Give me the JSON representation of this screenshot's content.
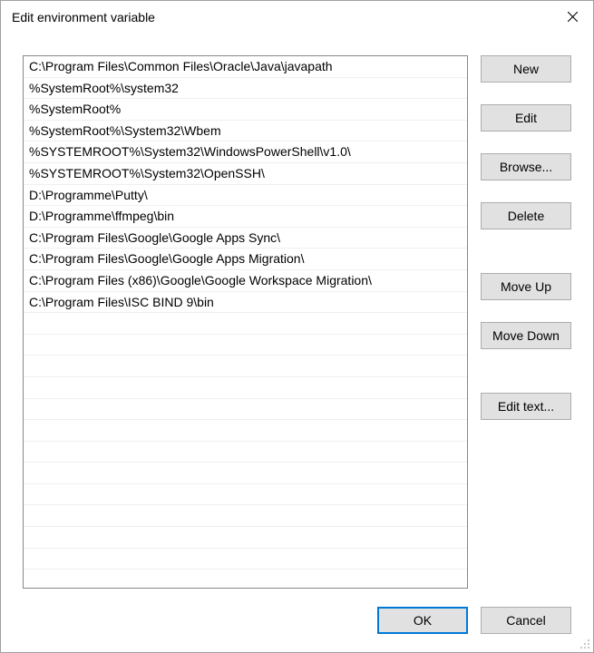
{
  "window": {
    "title": "Edit environment variable"
  },
  "paths": [
    "C:\\Program Files\\Common Files\\Oracle\\Java\\javapath",
    "%SystemRoot%\\system32",
    "%SystemRoot%",
    "%SystemRoot%\\System32\\Wbem",
    "%SYSTEMROOT%\\System32\\WindowsPowerShell\\v1.0\\",
    "%SYSTEMROOT%\\System32\\OpenSSH\\",
    "D:\\Programme\\Putty\\",
    "D:\\Programme\\ffmpeg\\bin",
    "C:\\Program Files\\Google\\Google Apps Sync\\",
    "C:\\Program Files\\Google\\Google Apps Migration\\",
    "C:\\Program Files (x86)\\Google\\Google Workspace Migration\\",
    "C:\\Program Files\\ISC BIND 9\\bin"
  ],
  "empty_rows": 12,
  "buttons": {
    "new": "New",
    "edit": "Edit",
    "browse": "Browse...",
    "delete": "Delete",
    "move_up": "Move Up",
    "move_down": "Move Down",
    "edit_text": "Edit text...",
    "ok": "OK",
    "cancel": "Cancel"
  }
}
